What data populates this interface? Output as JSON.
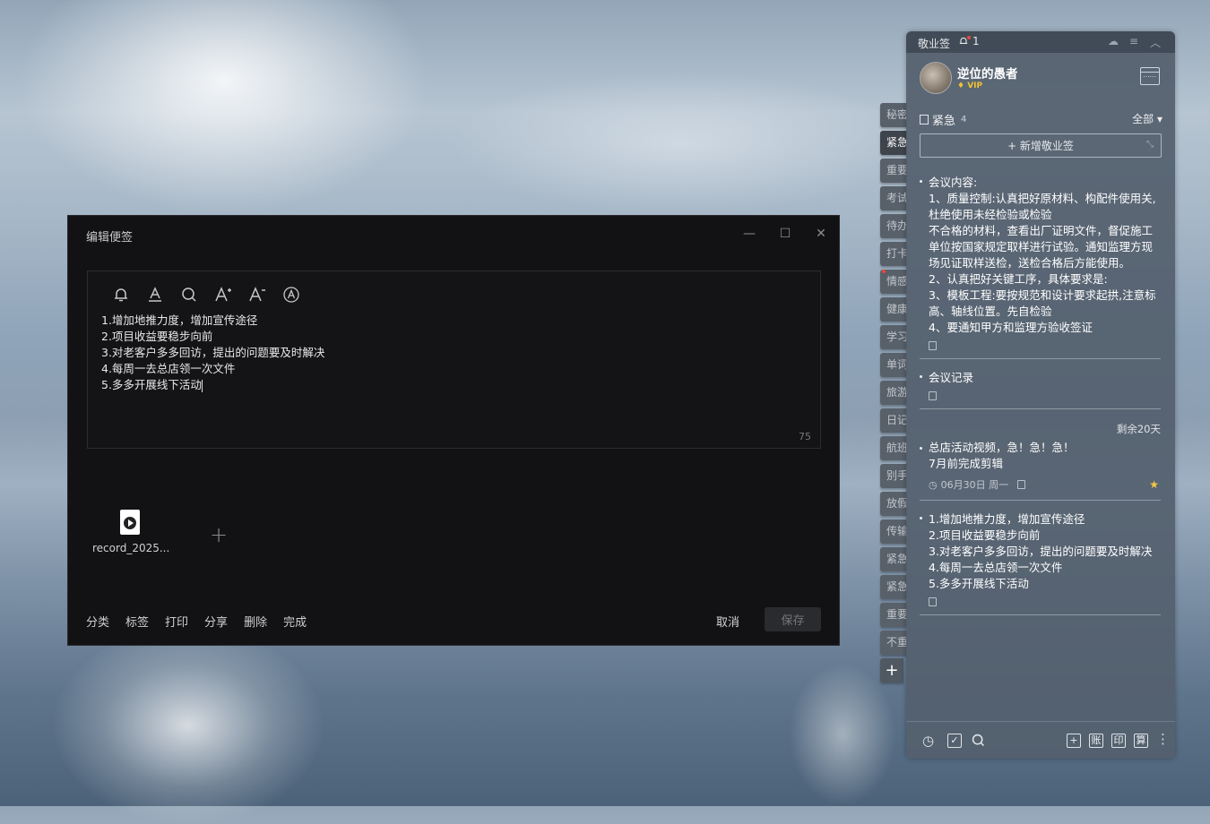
{
  "editor": {
    "title": "编辑便签",
    "minimize": "—",
    "maximize": "☐",
    "close": "✕",
    "lines": [
      "1.增加地推力度，增加宣传途径",
      "2.项目收益要稳步向前",
      "3.对老客户多多回访，提出的问题要及时解决",
      "4.每周一去总店领一次文件",
      "5.多多开展线下活动"
    ],
    "char_count": "75",
    "attachment_name": "record_2025...",
    "add_attachment": "+",
    "actions": [
      "分类",
      "标签",
      "打印",
      "分享",
      "删除",
      "完成"
    ],
    "cancel": "取消",
    "save": "保存"
  },
  "side_tabs": [
    "秘密",
    "紧急",
    "重要",
    "考试",
    "待办",
    "打卡",
    "情感",
    "健康",
    "学习",
    "单词",
    "旅游",
    "日记",
    "航班",
    "别手",
    "放假",
    "传输",
    "紧急",
    "紧急",
    "重要",
    "不重"
  ],
  "side_tab_add": "+",
  "panel": {
    "app_name": "敬业签",
    "bell_count": "1",
    "user_name": "逆位的愚者",
    "vip": "VIP",
    "category": "紧急",
    "category_count": "4",
    "filter": "全部 ▾",
    "add_note": "+ 新增敬业签",
    "notes": [
      {
        "text": "会议内容:\n1、质量控制:认真把好原材料、构配件使用关,杜绝使用未经检验或检验\n不合格的材料，查看出厂证明文件，督促施工单位按国家规定取样进行试验。通知监理方现场见证取样送检，送检合格后方能使用。\n2、认真把好关键工序，具体要求是:\n3、模板工程:要按规范和设计要求起拱,注意标高、轴线位置。先自检验\n4、要通知甲方和监理方验收签证"
      },
      {
        "text": "会议记录"
      },
      {
        "remain": "剩余20天",
        "text": "总店活动视频，急！急！急！\n7月前完成剪辑",
        "date": "06月30日 周一"
      },
      {
        "text": "1.增加地推力度，增加宣传途径\n2.项目收益要稳步向前\n3.对老客户多多回访，提出的问题要及时解决\n4.每周一去总店领一次文件\n5.多多开展线下活动"
      }
    ],
    "footer_boxes": [
      "+",
      "账",
      "印",
      "算"
    ]
  }
}
